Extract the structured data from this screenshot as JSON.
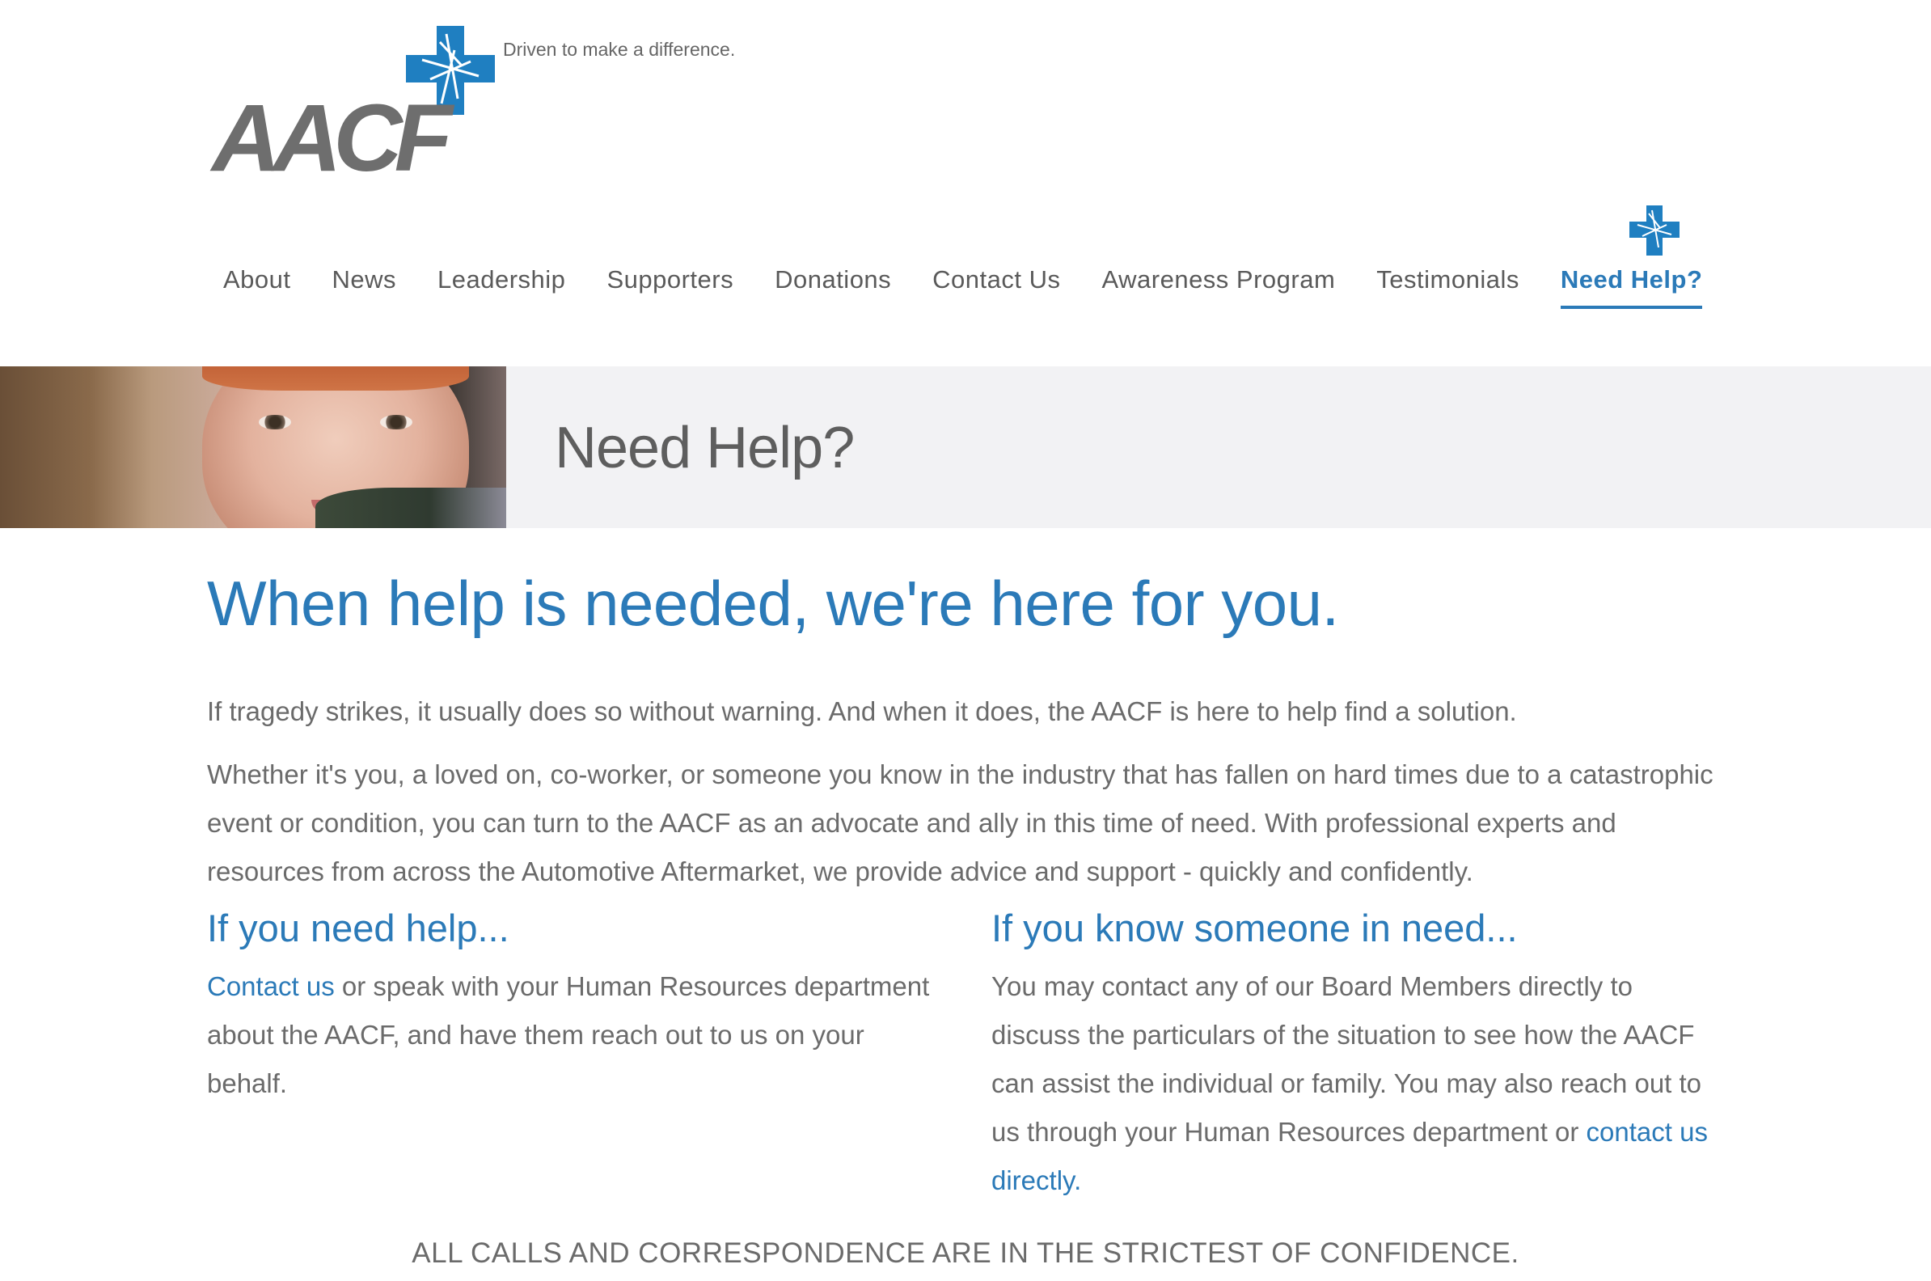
{
  "header": {
    "logo_text": "AACF",
    "tagline": "Driven to make a difference."
  },
  "nav": {
    "items": [
      {
        "label": "About"
      },
      {
        "label": "News"
      },
      {
        "label": "Leadership"
      },
      {
        "label": "Supporters"
      },
      {
        "label": "Donations"
      },
      {
        "label": "Contact Us"
      },
      {
        "label": "Awareness Program"
      },
      {
        "label": "Testimonials"
      },
      {
        "label": "Need Help?",
        "active": true
      }
    ]
  },
  "banner": {
    "title": "Need Help?"
  },
  "content": {
    "headline": "When help is needed, we're here for you.",
    "intro": "If tragedy strikes, it usually does so without warning. And when it does, the AACF is here to help find a solution.",
    "body": "Whether it's you, a loved on, co-worker, or someone you know in the industry that has fallen on hard times due to a catastrophic event or condition, you can turn to the AACF as an advocate and ally in this time of need. With professional experts and resources from across the Automotive Aftermarket, we provide advice and support - quickly and confidently.",
    "left": {
      "heading": "If you need help...",
      "link_text": "Contact us",
      "text": " or speak with your Human Resources department about the AACF, and have them reach out to us on your behalf."
    },
    "right": {
      "heading": "If you know someone in need...",
      "text": "You may contact any of our Board Members directly to discuss the particulars of the situation to see how the AACF can assist the individual or family. You may also reach out to us through your Human Resources department or ",
      "link_text": "contact us directly",
      "after_link": "."
    },
    "confidential": "ALL CALLS AND CORRESPONDENCE ARE IN THE STRICTEST OF CONFIDENCE."
  },
  "colors": {
    "accent": "#2b7ab8",
    "text": "#6b6b6b",
    "banner_bg": "#f2f2f4"
  }
}
